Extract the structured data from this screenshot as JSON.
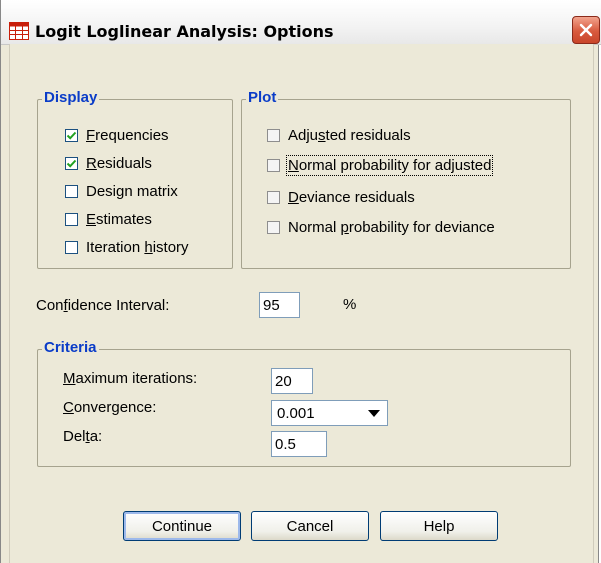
{
  "window": {
    "title": "Logit Loglinear Analysis: Options"
  },
  "display": {
    "legend": "Display",
    "items": [
      {
        "prefix": "",
        "ul": "F",
        "suffix": "requencies",
        "checked": true
      },
      {
        "prefix": "",
        "ul": "R",
        "suffix": "esiduals",
        "checked": true
      },
      {
        "prefix": "Desi",
        "ul": "g",
        "suffix": "n matrix",
        "checked": false
      },
      {
        "prefix": "",
        "ul": "E",
        "suffix": "stimates",
        "checked": false
      },
      {
        "prefix": "Iteration ",
        "ul": "h",
        "suffix": "istory",
        "checked": false
      }
    ]
  },
  "plot": {
    "legend": "Plot",
    "items": [
      {
        "prefix": "Adju",
        "ul": "s",
        "suffix": "ted residuals",
        "checked": false
      },
      {
        "prefix": "",
        "ul": "N",
        "suffix": "ormal probability for adjusted",
        "checked": false
      },
      {
        "prefix": "",
        "ul": "D",
        "suffix": "eviance residuals",
        "checked": false
      },
      {
        "prefix": "Normal ",
        "ul": "p",
        "suffix": "robability for deviance",
        "checked": false
      }
    ]
  },
  "confidence": {
    "prefix": "Con",
    "ul": "f",
    "suffix": "idence Interval:",
    "value": "95",
    "unit": "%"
  },
  "criteria": {
    "legend": "Criteria",
    "max_iter": {
      "prefix": "",
      "ul": "M",
      "suffix": "aximum iterations:",
      "value": "20"
    },
    "convergence": {
      "prefix": "",
      "ul": "C",
      "suffix": "onvergence:",
      "value": "0.001"
    },
    "delta": {
      "prefix": "Del",
      "ul": "t",
      "suffix": "a:",
      "value": "0.5"
    }
  },
  "buttons": {
    "continue": "Continue",
    "cancel": "Cancel",
    "help": "Help"
  },
  "colors": {
    "legend_blue": "#0a3cc8",
    "dialog_bg": "#ece9d8",
    "close_red": "#d85a3e"
  }
}
